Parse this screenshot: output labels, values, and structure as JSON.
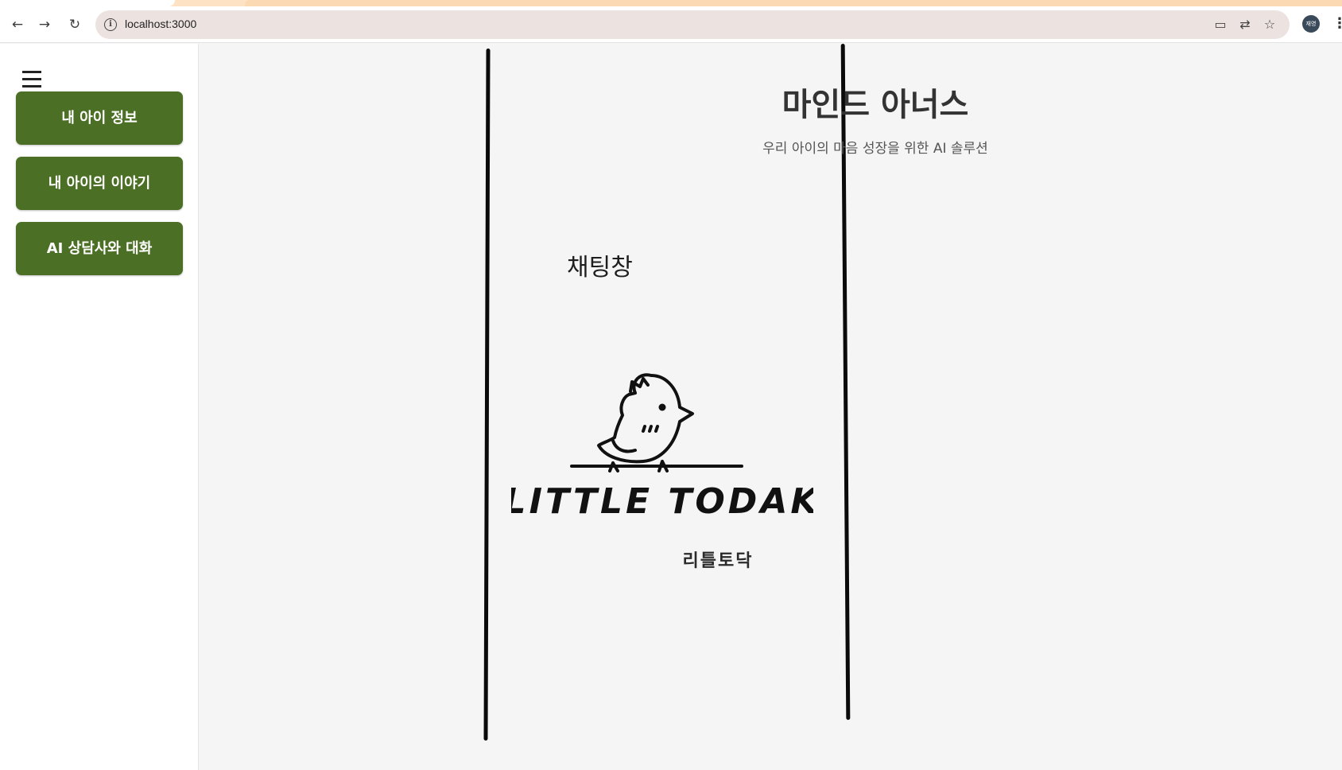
{
  "browser": {
    "url": "localhost:3000",
    "profile_initials": "재영"
  },
  "sidebar": {
    "menu_icon": "hamburger-icon",
    "items": [
      {
        "label": "내 아이 정보"
      },
      {
        "label": "내 아이의 이야기"
      },
      {
        "label": "AI 상담사와 대화"
      }
    ],
    "button_color": "#4b6f24"
  },
  "main": {
    "title": "마인드 아너스",
    "subtitle": "우리 아이의 마음 성장을 위한 AI 솔루션",
    "chat_label": "채팅창",
    "logo": {
      "wordmark": "LITTLE TODAK",
      "korean_name": "리틀토닥",
      "icon": "chick-on-branch-logo"
    }
  }
}
